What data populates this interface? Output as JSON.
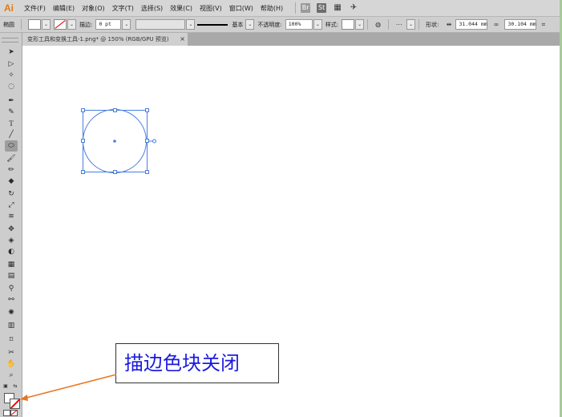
{
  "app": {
    "logo": "Ai"
  },
  "menu": {
    "items": [
      "文件(F)",
      "编辑(E)",
      "对象(O)",
      "文字(T)",
      "选择(S)",
      "效果(C)",
      "视图(V)",
      "窗口(W)",
      "帮助(H)"
    ],
    "icons": {
      "br": "Br",
      "st": "St",
      "arrange": "▦",
      "gpu": "✈"
    }
  },
  "control": {
    "path_label": "椭圆",
    "stroke_label": "描边:",
    "stroke_value": "0 pt",
    "profile_label": "基本",
    "opacity_label": "不透明度:",
    "opacity_value": "100%",
    "style_label": "样式:",
    "shape_label": "形状:",
    "width_value": "31.044 mm",
    "height_value": "30.104 mm",
    "chevron": "⌄"
  },
  "document": {
    "tab_title": "变形工具和变换工具-1.png* @ 150% (RGB/GPU 预览)",
    "close": "×"
  },
  "callout": {
    "text": "描边色块关闭"
  },
  "colors": {
    "arrow": "#e87722",
    "callout_text": "#1b1be0",
    "selection": "#4a7ee0"
  }
}
